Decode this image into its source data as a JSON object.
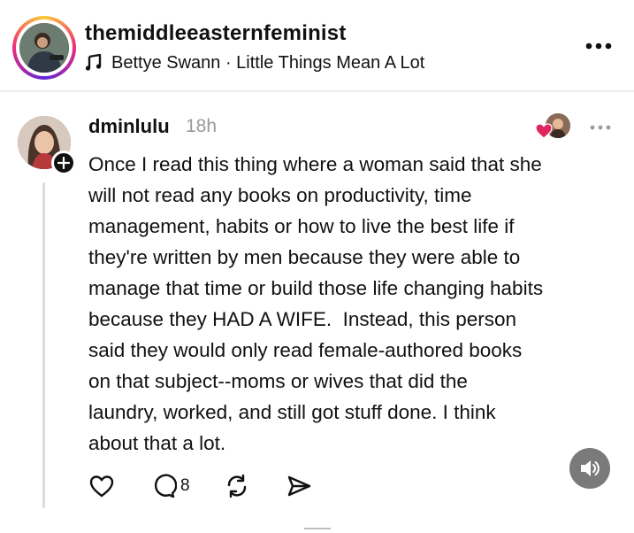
{
  "header": {
    "account_name": "themiddleeasternfeminist",
    "music": "Bettye Swann · Little Things Mean A Lot",
    "icons": [
      "music-note-icon",
      "more-icon"
    ]
  },
  "comment": {
    "username": "dminlulu",
    "timestamp": "18h",
    "text": "Once I read this thing where a woman said that she\nwill not read any books on productivity, time\nmanagement, habits or how to live the best life if\nthey're written by men because they were able to\nmanage that time or build those life changing habits\nbecause they HAD A WIFE.  Instead, this person\nsaid they would only read female-authored books\non that subject--moms or wives that did the\nlaundry, worked, and still got stuff done. I think\nabout that a lot.",
    "liked_by_creator": true,
    "actions": {
      "reply_count": "8",
      "icons": [
        "heart-icon",
        "reply-icon",
        "repost-icon",
        "share-icon"
      ]
    }
  },
  "controls": {
    "sound_icon": "speaker-icon"
  },
  "colors": {
    "text": "#111111",
    "muted": "#9a9a9a",
    "heart": "#e0245e",
    "sound_button": "#7a7a7a"
  }
}
